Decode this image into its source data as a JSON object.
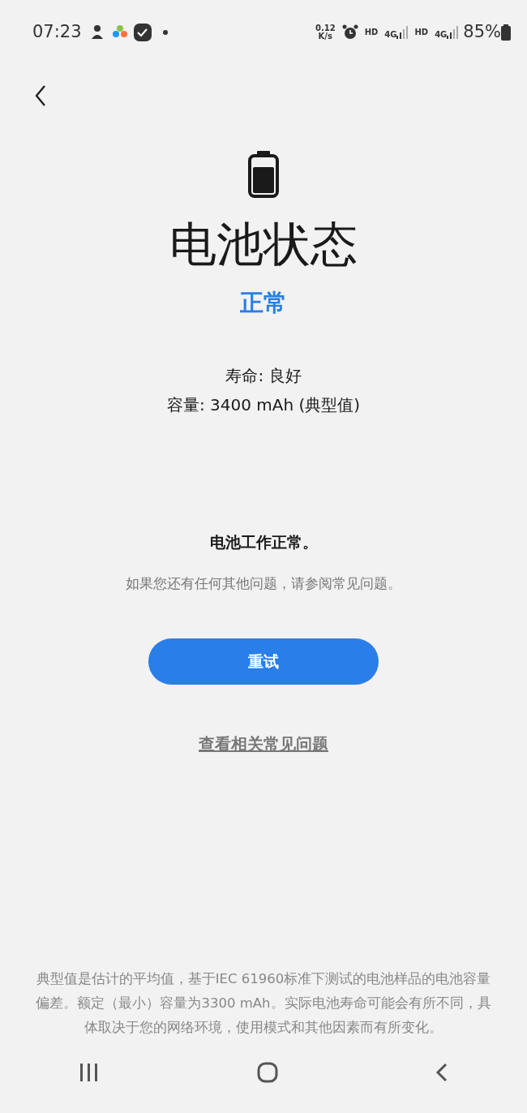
{
  "status_bar": {
    "time": "07:23",
    "speed_value": "0.12",
    "speed_unit": "K/s",
    "network": [
      {
        "hd": "HD",
        "gen": "4G"
      },
      {
        "hd": "HD",
        "gen": "4G"
      }
    ],
    "battery": "85%"
  },
  "title": "电池状态",
  "status": "正常",
  "details": [
    "寿命: 良好",
    "容量: 3400 mAh (典型值)"
  ],
  "message": "电池工作正常。",
  "hint": "如果您还有任何其他问题，请参阅常见问题。",
  "retry_button": "重试",
  "faq_link": "查看相关常见问题",
  "footnote": "典型值是估计的平均值，基于IEC 61960标准下测试的电池样品的电池容量偏差。额定（最小）容量为3300 mAh。实际电池寿命可能会有所不同，具体取决于您的网络环境，使用模式和其他因素而有所变化。"
}
